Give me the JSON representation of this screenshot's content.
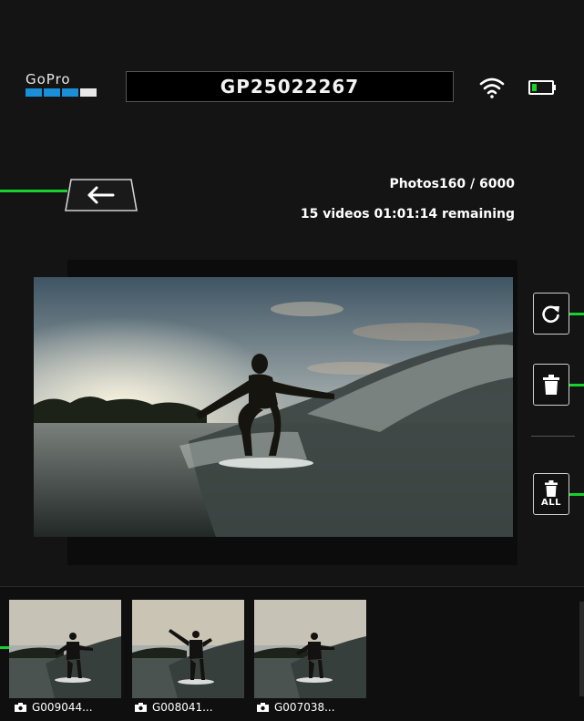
{
  "brand": {
    "logo_text": "GoPro"
  },
  "header": {
    "camera_name": "GP25022267"
  },
  "status": {
    "photos_label": "Photos",
    "photos_count": "160 / 6000",
    "videos": "15 videos",
    "remaining": "01:01:14 remaining"
  },
  "actions": {
    "delete_all_label": "ALL"
  },
  "thumbnails": [
    {
      "label": "G009044..."
    },
    {
      "label": "G008041..."
    },
    {
      "label": "G007038..."
    }
  ],
  "colors": {
    "accent_green": "#19d12c",
    "gopro_blue": "#1a8fd8"
  },
  "icons": [
    "wifi-icon",
    "battery-icon",
    "back-arrow-icon",
    "rotate-icon",
    "trash-icon",
    "camera-icon"
  ]
}
